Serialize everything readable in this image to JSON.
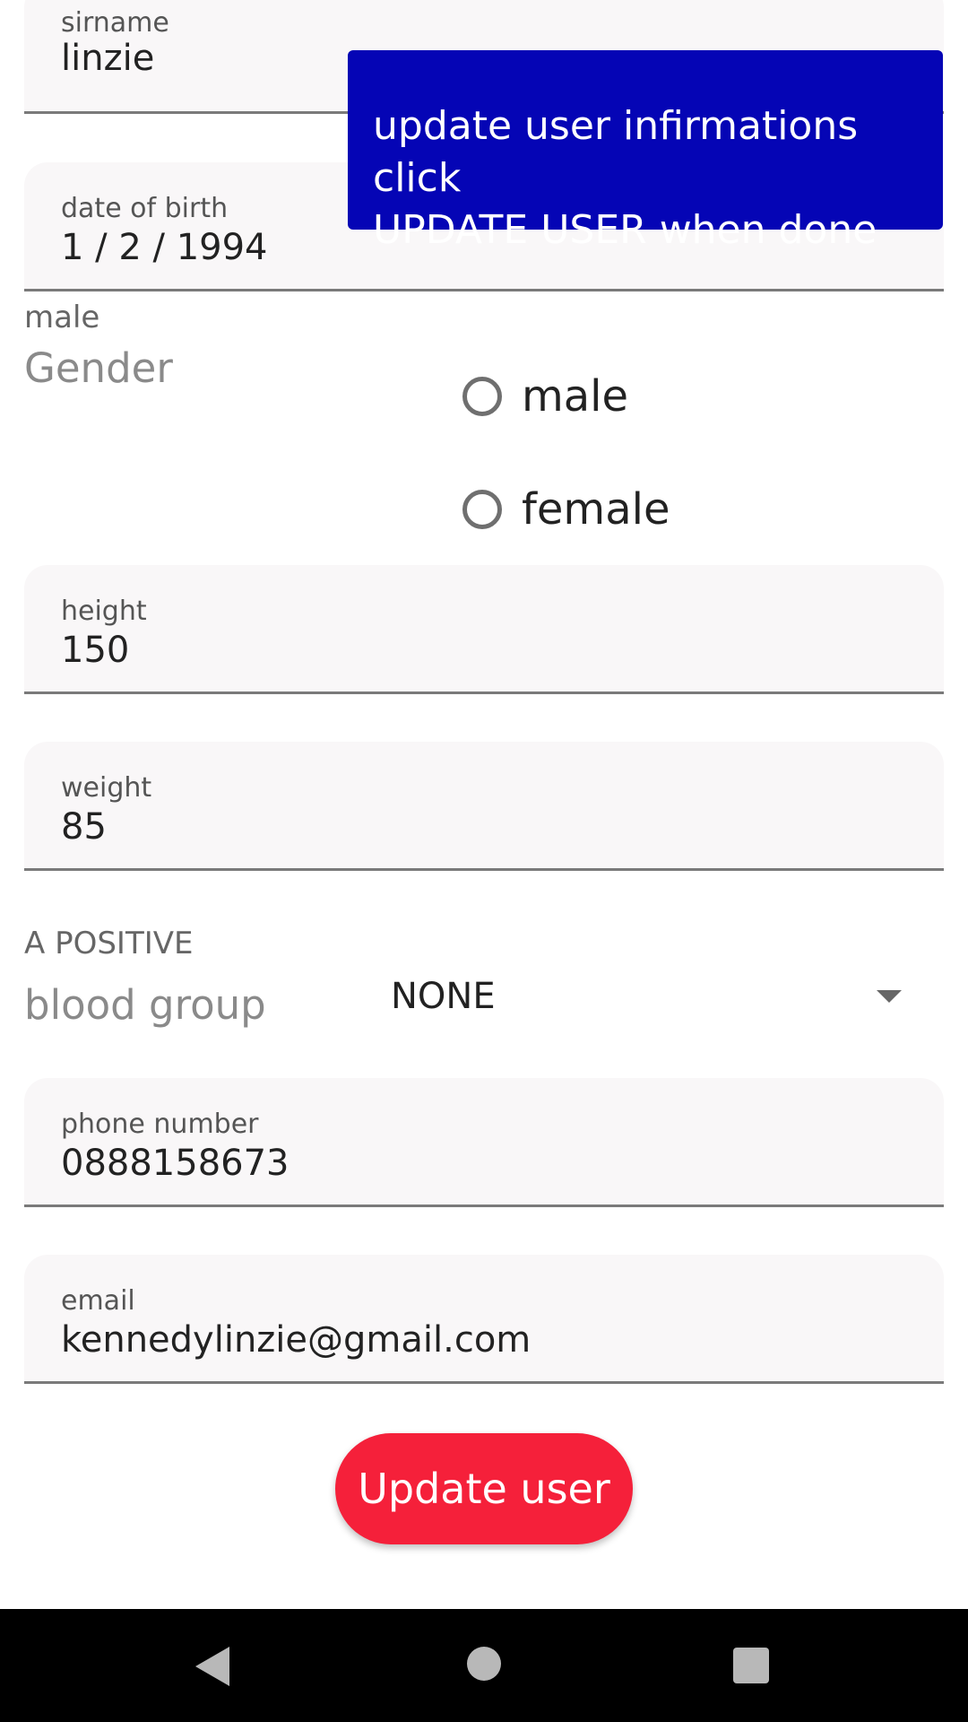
{
  "form": {
    "surname": {
      "label": "sirname",
      "value": "linzie"
    },
    "dob": {
      "label": "date of birth",
      "value": "1 / 2 / 1994"
    },
    "gender": {
      "selected_text": "male",
      "hint": "Gender",
      "options": [
        "male",
        "female"
      ]
    },
    "height": {
      "label": "height",
      "value": "150"
    },
    "weight": {
      "label": "weight",
      "value": "85"
    },
    "blood_group": {
      "selected_text": "A POSITIVE",
      "hint": "blood group",
      "dropdown_value": "NONE"
    },
    "phone": {
      "label": "phone number",
      "value": "0888158673"
    },
    "email": {
      "label": "email",
      "value": "kennedylinzie@gmail.com"
    }
  },
  "tooltip": {
    "line1": "update user infirmations click",
    "line2": "UPDATE USER when done"
  },
  "actions": {
    "update_label": "Update user"
  },
  "icons": {
    "radio": "radio-unchecked-icon",
    "dropdown": "chevron-down-icon",
    "nav_back": "back-triangle-icon",
    "nav_home": "home-circle-icon",
    "nav_recent": "recent-square-icon"
  },
  "colors": {
    "tooltip_bg": "#0505b5",
    "button_bg": "#f5203a",
    "field_bg": "#f9f7f8",
    "navbar_bg": "#000000"
  }
}
